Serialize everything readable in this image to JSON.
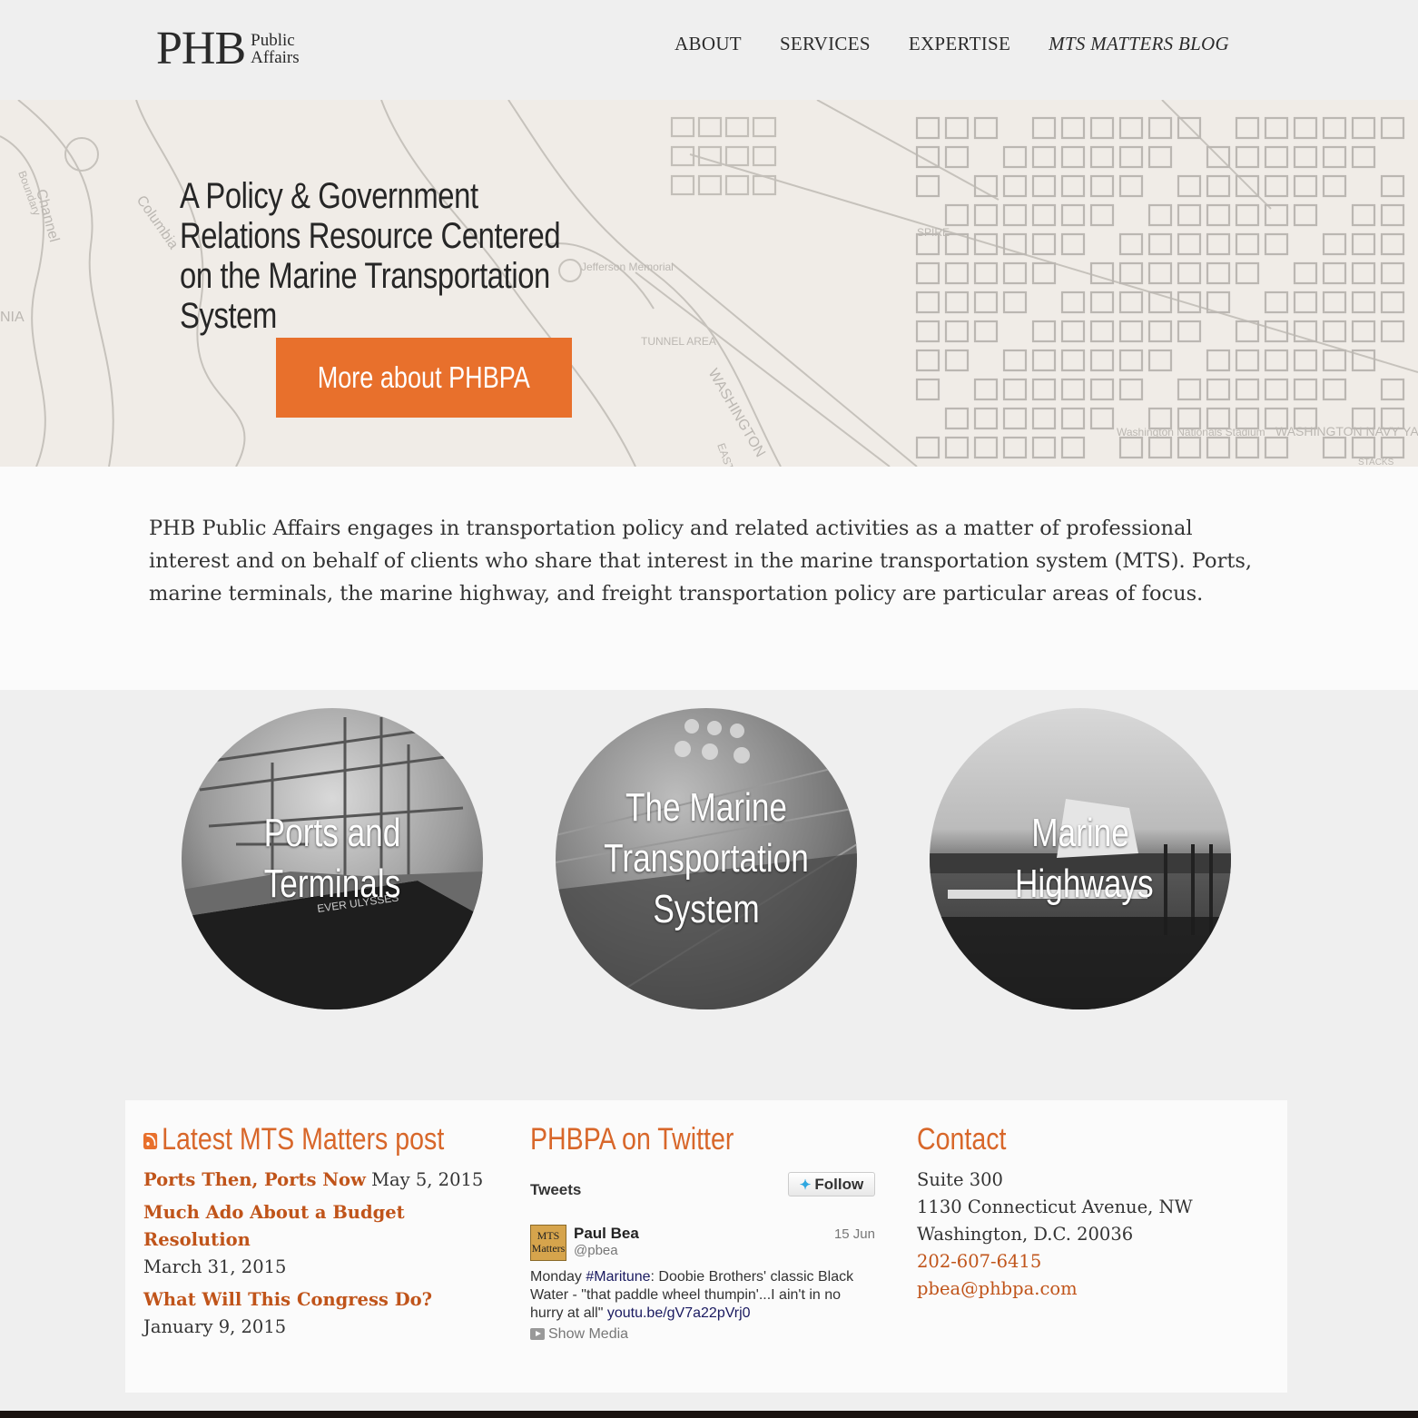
{
  "logo": {
    "main": "PHB",
    "line1": "Public",
    "line2": "Affairs"
  },
  "nav": [
    "ABOUT",
    "SERVICES",
    "EXPERTISE",
    "MTS MATTERS BLOG"
  ],
  "hero": {
    "title": "A Policy & Government Relations Resource Centered on the Marine Transportation System",
    "button": "More about PHBPA",
    "map_labels": {
      "boundary": "Boundary",
      "channel": "Channel",
      "columbia": "Columbia",
      "nia": "NIA",
      "memorial": "Jefferson Memorial",
      "tunnel": "TUNNEL AREA",
      "washington": "WASHINGTON",
      "spire": "SPIRE",
      "nationals": "Washington Nationals Stadium",
      "navy": "WASHINGTON NAVY YA",
      "east": "EAST",
      "stacks": "STACKS"
    }
  },
  "intro": "PHB Public Affairs engages in transportation policy and related activities as a matter of professional interest and on behalf of clients who share that interest in the marine transportation system (MTS). Ports, marine terminals, the marine highway, and freight transportation policy are particular areas of focus.",
  "circles": [
    {
      "label": "Ports and Terminals",
      "ship_text": "EVER ULYSSES"
    },
    {
      "label": "The Marine Transportation System"
    },
    {
      "label": "Marine Highways"
    }
  ],
  "blog": {
    "title": "Latest MTS Matters post",
    "posts": [
      {
        "title": "Ports Then, Ports Now",
        "date": "May 5, 2015"
      },
      {
        "title": "Much Ado About a Budget Resolution",
        "date": "March 31, 2015"
      },
      {
        "title": "What Will This Congress Do?",
        "date": "January 9, 2015"
      }
    ]
  },
  "twitter": {
    "title": "PHBPA on Twitter",
    "tweets_label": "Tweets",
    "follow": "Follow",
    "avatar_text": "MTS Matters",
    "name": "Paul Bea",
    "handle": "@pbea",
    "date": "15 Jun",
    "text_a": "Monday ",
    "hashtag": "#Maritune",
    "text_b": ": Doobie Brothers' classic Black Water - \"that paddle wheel thumpin'...I ain't in no hurry at all\"  ",
    "link": "youtu.be/gV7a22pVrj0",
    "media": "Show Media"
  },
  "contact": {
    "title": "Contact",
    "line1": "Suite 300",
    "line2": "1130 Connecticut Avenue, NW",
    "line3": "Washington, D.C. 20036",
    "phone": "202-607-6415",
    "email": "pbea@phbpa.com"
  },
  "colors": {
    "accent": "#e8702c",
    "link": "#c0541a"
  }
}
